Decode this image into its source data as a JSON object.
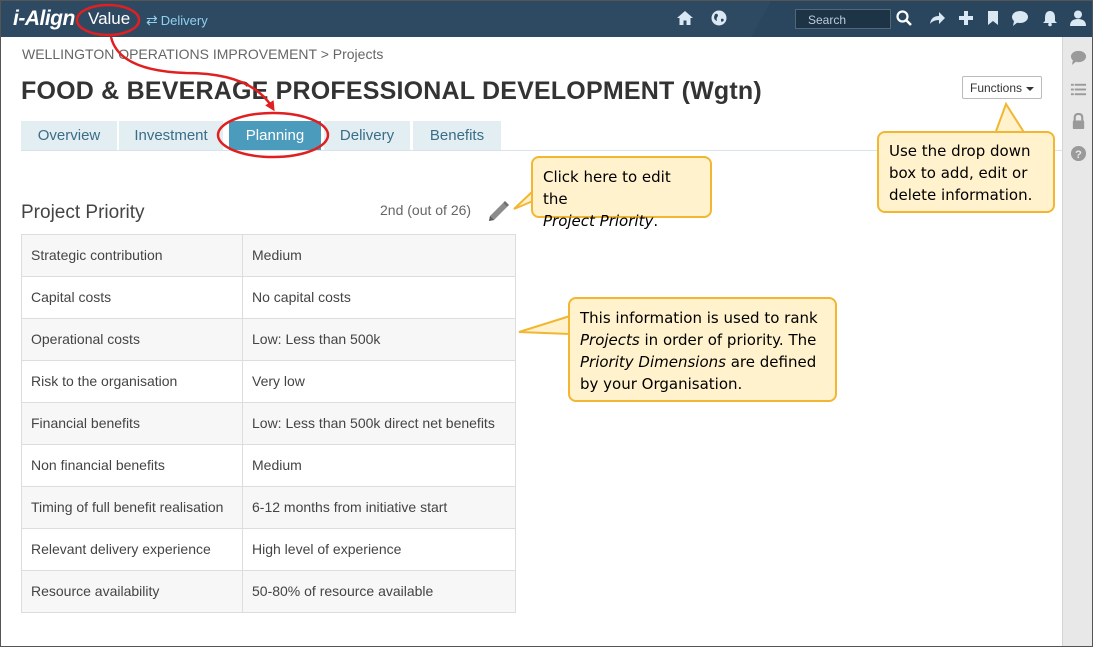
{
  "topbar": {
    "logo": "i-Align",
    "context_label": "Value",
    "delivery_label": "Delivery",
    "search_placeholder": "Search"
  },
  "breadcrumb": "WELLINGTON OPERATIONS IMPROVEMENT > Projects",
  "page_title": "FOOD & BEVERAGE PROFESSIONAL DEVELOPMENT (Wgtn)",
  "functions_label": "Functions",
  "tabs": [
    {
      "label": "Overview"
    },
    {
      "label": "Investment"
    },
    {
      "label": "Planning"
    },
    {
      "label": "Delivery"
    },
    {
      "label": "Benefits"
    }
  ],
  "active_tab": "Planning",
  "section": {
    "title": "Project Priority",
    "rank": "2nd (out of 26)"
  },
  "priority_rows": [
    {
      "key": "Strategic contribution",
      "value": "Medium"
    },
    {
      "key": "Capital costs",
      "value": "No capital costs"
    },
    {
      "key": "Operational costs",
      "value": "Low: Less than 500k"
    },
    {
      "key": "Risk to the organisation",
      "value": "Very low"
    },
    {
      "key": "Financial benefits",
      "value": "Low: Less than 500k direct net benefits"
    },
    {
      "key": "Non financial benefits",
      "value": "Medium"
    },
    {
      "key": "Timing of full benefit realisation",
      "value": "6-12 months from initiative start"
    },
    {
      "key": "Relevant delivery experience",
      "value": "High level of experience"
    },
    {
      "key": "Resource availability",
      "value": "50-80% of resource available"
    }
  ],
  "callouts": {
    "edit": {
      "line1": "Click here to edit the",
      "line2": "Project Priority",
      "suffix": "."
    },
    "functions": {
      "text": "Use the drop down box to add, edit or delete information."
    },
    "info": {
      "part1": "This information is used to rank",
      "part2_em": "Projects",
      "part3": " in order of priority.  The",
      "part4_em": "Priority Dimensions",
      "part5": " are defined by your Organisation."
    }
  },
  "colors": {
    "topbar": "#2e4a63",
    "active_tab": "#4b9bbd",
    "tab": "#e3eef3",
    "callout_fill": "#fff2cc",
    "callout_border": "#f2b632",
    "annotation_red": "#e02020"
  },
  "icons": [
    "home-icon",
    "globe-icon",
    "search-icon",
    "share-icon",
    "plus-icon",
    "bookmark-icon",
    "chat-icon",
    "bell-icon",
    "user-icon",
    "pencil-icon",
    "comment-icon",
    "list-icon",
    "lock-icon",
    "help-icon"
  ]
}
